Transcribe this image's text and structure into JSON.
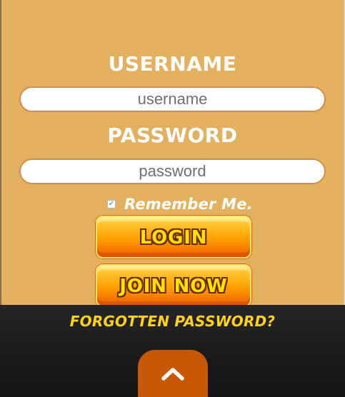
{
  "form": {
    "username_label": "USERNAME",
    "username_placeholder": "username",
    "password_label": "PASSWORD",
    "password_placeholder": "password",
    "remember_label": "Remember Me.",
    "remember_checked": true,
    "login_button": "LOGIN",
    "join_button": "JOIN NOW"
  },
  "footer": {
    "forgot_password": "FORGOTTEN PASSWORD?",
    "scroll_up_icon": "chevron-up-icon"
  },
  "colors": {
    "panel_background": "#e3b05f",
    "footer_background": "#1b1b1b",
    "accent_orange": "#c75807",
    "button_yellow": "#ffe000",
    "button_orange": "#ff9f00",
    "text_white": "#ffffff",
    "link_yellow": "#ffd21d"
  }
}
